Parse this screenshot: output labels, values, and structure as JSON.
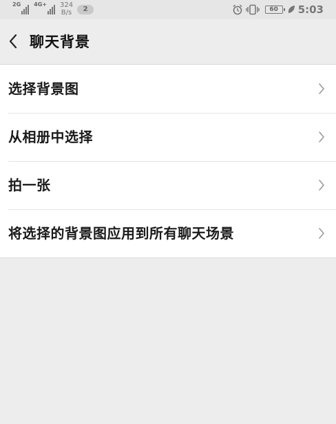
{
  "status_bar": {
    "sim1_label": "2G",
    "sim2_label": "4G+",
    "network_speed_value": "324",
    "network_speed_unit": "B/s",
    "notification_count": "2",
    "battery_level": "60",
    "time": "5:03"
  },
  "header": {
    "title": "聊天背景"
  },
  "menu": {
    "items": [
      {
        "label": "选择背景图"
      },
      {
        "label": "从相册中选择"
      },
      {
        "label": "拍一张"
      },
      {
        "label": "将选择的背景图应用到所有聊天场景"
      }
    ]
  },
  "icons": {
    "back": "chevron-left-icon",
    "chevron": "chevron-right-icon",
    "alarm": "alarm-icon",
    "vibrate": "vibrate-icon",
    "battery": "battery-icon",
    "leaf": "leaf-icon"
  },
  "colors": {
    "background": "#ededed",
    "list_background": "#ffffff",
    "text": "#1a1a1a",
    "chevron": "#9a9a9a"
  }
}
